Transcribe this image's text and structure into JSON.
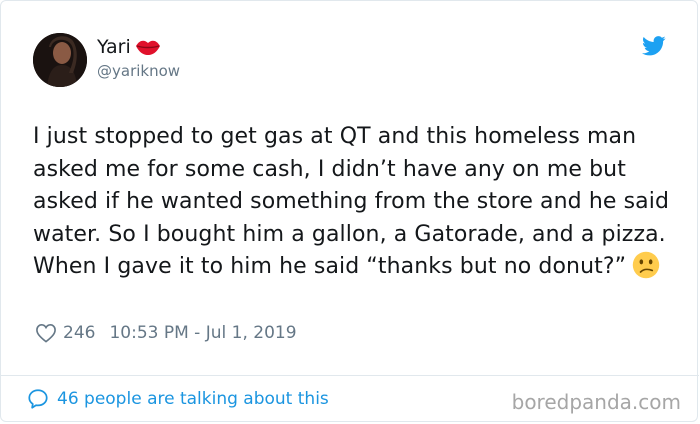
{
  "user": {
    "display_name": "Yari",
    "handle": "@yariknow",
    "name_emoji_icon": "kiss-lips-icon"
  },
  "brand_icon": "twitter-bird-icon",
  "tweet": {
    "text": "I just stopped to get gas at QT and this homeless man asked me for some cash, I didn’t have any on me but asked if he wanted something from the store and he said water. So I bought him a gallon, a Gatorade, and a pizza. When I gave it to him he said “thanks but no donut?”",
    "trailing_emoji_icon": "confused-face-icon"
  },
  "meta": {
    "like_icon": "heart-outline-icon",
    "likes": "246",
    "timestamp": "10:53 PM - Jul 1, 2019"
  },
  "footer": {
    "talk_icon": "speech-bubble-icon",
    "talking_text": "46 people are talking about this"
  },
  "watermark": "boredpanda.com",
  "colors": {
    "link_blue": "#1b95e0",
    "twitter_blue": "#1da1f2",
    "secondary_text": "#657786",
    "lips_red": "#e0112b",
    "emoji_yellow": "#ffcc4d"
  }
}
